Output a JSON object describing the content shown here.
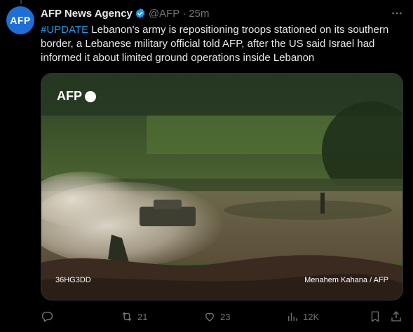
{
  "author": {
    "avatar_text": "AFP",
    "name": "AFP News Agency",
    "handle": "@AFP",
    "time": "25m"
  },
  "tweet": {
    "hashtag": "#UPDATE",
    "text": " Lebanon's army is repositioning troops stationed on its southern border, a Lebanese military official told AFP, after the US said Israel had informed it about limited ground operations inside Lebanon"
  },
  "media": {
    "logo_text": "AFP",
    "photo_id": "36HG3DD",
    "credit": "Menahem Kahana / AFP"
  },
  "actions": {
    "replies": "",
    "reposts": "21",
    "likes": "23",
    "views": "12K"
  },
  "colors": {
    "accent": "#1d9bf0",
    "verified": "#1d9bf0",
    "muted": "#71767b",
    "avatar_bg": "#1d6fd8"
  }
}
